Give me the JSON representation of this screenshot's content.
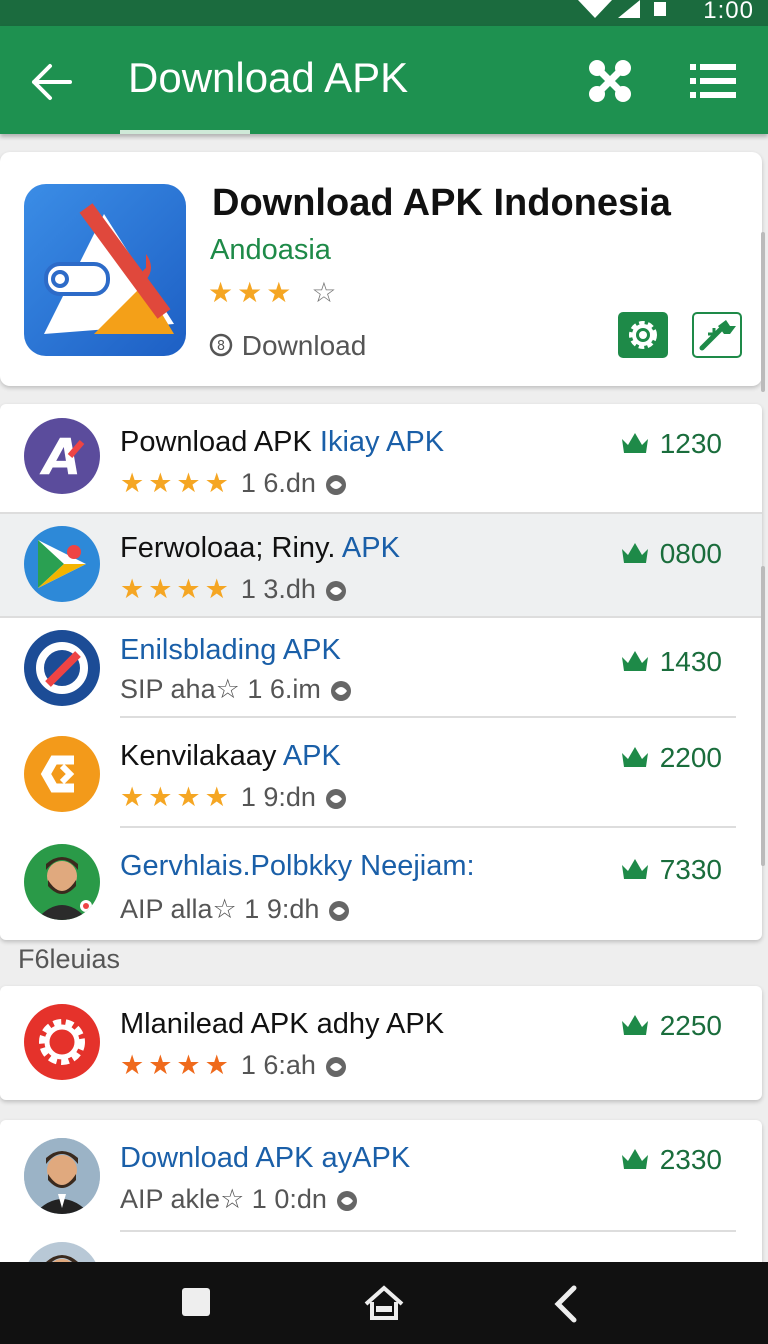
{
  "status_bar": {
    "time": "1:00"
  },
  "app_bar": {
    "title": "Download APK"
  },
  "header": {
    "app_name": "Download APK Indonesia",
    "developer": "Andoasia",
    "stars_filled": "★★★",
    "stars_empty": "☆",
    "rating": 3,
    "download_label": "Download"
  },
  "list": [
    {
      "title_main": "Pownload APK ",
      "title_blue": "Ikiay APK",
      "stars": "★★★★",
      "meta": "1 6.dn",
      "count": "1230",
      "highlighted": false
    },
    {
      "title_main": "Ferwoloaa; Riny. ",
      "title_blue": "APK",
      "stars": "★★★★",
      "meta": "1 3.dh",
      "count": "0800",
      "highlighted": true
    },
    {
      "title_main": "",
      "title_blue": "Enilsblading APK",
      "prefix": "SIP aha☆",
      "meta": "1 6.im",
      "count": "1430",
      "highlighted": false
    },
    {
      "title_main": "Kenvilakaay ",
      "title_blue": "APK",
      "stars": "★★★★",
      "meta": "1 9:dn",
      "count": "2200",
      "highlighted": false
    },
    {
      "title_main": "",
      "title_blue": "Gervhlais.Polbkky Neejiam:",
      "prefix": "AIP alla☆",
      "meta": "1 9:dh",
      "count": "7330",
      "highlighted": false
    }
  ],
  "section_label": "F6leuias",
  "list2": [
    {
      "title_main": "Mlanilead APK adhy APK",
      "stars": "★★★★",
      "meta": "1 6:ah",
      "count": "2250"
    }
  ],
  "list3": [
    {
      "title_blue": "Download APK ayAPK",
      "prefix": "AIP akle☆",
      "meta": "1 0:dn",
      "count": "2330"
    }
  ],
  "colors": {
    "app_bar": "#1e9150",
    "status_bar": "#1b6b3e",
    "accent_green": "#1e8a48",
    "link_blue": "#1a5fa8",
    "star": "#f5a623"
  }
}
